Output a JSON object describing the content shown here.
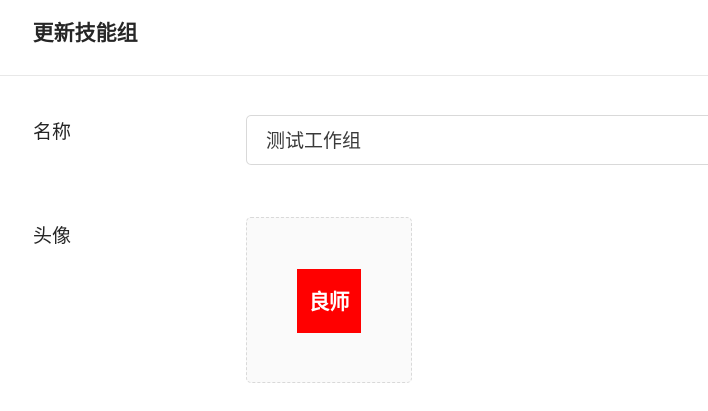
{
  "header": {
    "title": "更新技能组"
  },
  "form": {
    "name": {
      "label": "名称",
      "value": "测试工作组"
    },
    "avatar": {
      "label": "头像",
      "image_text": "良师",
      "image_background": "#ff0000"
    }
  }
}
